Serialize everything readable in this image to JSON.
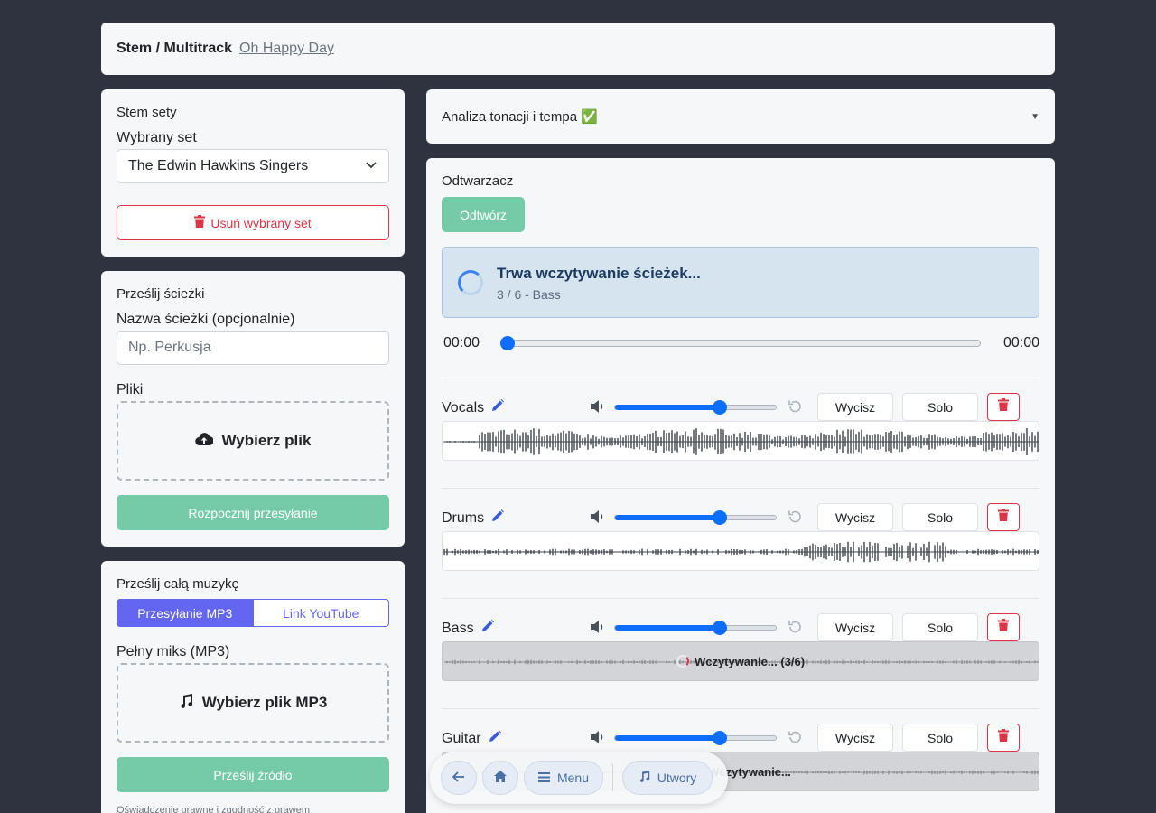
{
  "header": {
    "title": "Stem / Multitrack",
    "song_link": "Oh Happy Day"
  },
  "stem_sets": {
    "title": "Stem sety",
    "selected_label": "Wybrany set",
    "selected_value": "The Edwin Hawkins Singers",
    "delete_button": "Usuń wybrany set"
  },
  "upload_tracks": {
    "title": "Prześlij ścieżki",
    "name_label": "Nazwa ścieżki (opcjonalnie)",
    "name_placeholder": "Np. Perkusja",
    "files_label": "Pliki",
    "choose_file": "Wybierz plik",
    "start_upload": "Rozpocznij przesyłanie"
  },
  "upload_music": {
    "title": "Prześlij całą muzykę",
    "tab_mp3": "Przesyłanie MP3",
    "tab_youtube": "Link YouTube",
    "mix_label": "Pełny miks (MP3)",
    "choose_mp3": "Wybierz plik MP3",
    "submit": "Prześlij źródło",
    "footer_note": "Oświadczenie prawne i zgodność z prawem"
  },
  "analysis": {
    "title": "Analiza tonacji i tempa ✅"
  },
  "player": {
    "title": "Odtwarzacz",
    "play_button": "Odtwórz",
    "loading_title": "Trwa wczytywanie ścieżek...",
    "loading_sub": "3 / 6 - Bass",
    "time_current": "00:00",
    "time_total": "00:00",
    "progress": 0
  },
  "tracks": [
    {
      "name": "Vocals",
      "volume": 0.65,
      "mute": "Wycisz",
      "solo": "Solo",
      "state": "ready",
      "loading_text": ""
    },
    {
      "name": "Drums",
      "volume": 0.65,
      "mute": "Wycisz",
      "solo": "Solo",
      "state": "ready",
      "loading_text": ""
    },
    {
      "name": "Bass",
      "volume": 0.65,
      "mute": "Wycisz",
      "solo": "Solo",
      "state": "loading",
      "loading_text": "Wczytywanie... (3/6)"
    },
    {
      "name": "Guitar",
      "volume": 0.65,
      "mute": "Wycisz",
      "solo": "Solo",
      "state": "loading",
      "loading_text": "Wczytywanie..."
    }
  ],
  "bottom_nav": {
    "menu": "Menu",
    "tracks": "Utwory"
  },
  "colors": {
    "accent": "#6366f1",
    "success": "#75cba8",
    "danger": "#dc3545",
    "slider": "#0d6efd",
    "background": "#2f3340"
  }
}
